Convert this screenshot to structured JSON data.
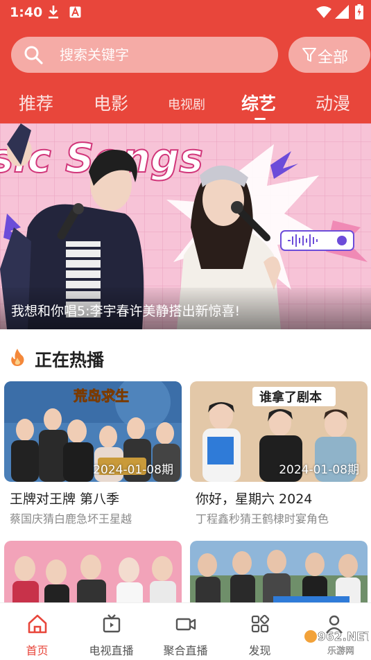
{
  "status_bar": {
    "time": "1:40"
  },
  "search": {
    "placeholder": "搜索关键字"
  },
  "filter": {
    "label": "全部"
  },
  "tabs": [
    {
      "label": "推荐",
      "active": false
    },
    {
      "label": "电影",
      "active": false
    },
    {
      "label": "电视剧",
      "active": false
    },
    {
      "label": "综艺",
      "active": true
    },
    {
      "label": "动漫",
      "active": false
    }
  ],
  "banner": {
    "art_text": "sic Songs",
    "caption": "我想和你唱5:李宇春许美静搭出新惊喜!"
  },
  "section": {
    "title": "正在热播"
  },
  "cards": [
    {
      "period": "2024-01-08期",
      "title": "王牌对王牌 第八季",
      "subtitle": "蔡国庆猜白鹿急坏王星越",
      "thumb_text": "荒岛求生"
    },
    {
      "period": "2024-01-08期",
      "title": "你好，星期六 2024",
      "subtitle": "丁程鑫秒猜王鹤棣时宴角色",
      "thumb_text": "谁拿了剧本"
    }
  ],
  "bottom_nav": [
    {
      "label": "首页",
      "icon": "home-icon",
      "active": true
    },
    {
      "label": "电视直播",
      "icon": "tv-icon",
      "active": false
    },
    {
      "label": "聚合直播",
      "icon": "video-camera-icon",
      "active": false
    },
    {
      "label": "发现",
      "icon": "grid-icon",
      "active": false
    },
    {
      "label": "",
      "icon": "user-icon",
      "active": false
    }
  ],
  "watermark": {
    "text": "962.NET",
    "sub": "乐游网"
  },
  "colors": {
    "accent": "#e8463b",
    "banner_pink": "#f4b7cf"
  }
}
